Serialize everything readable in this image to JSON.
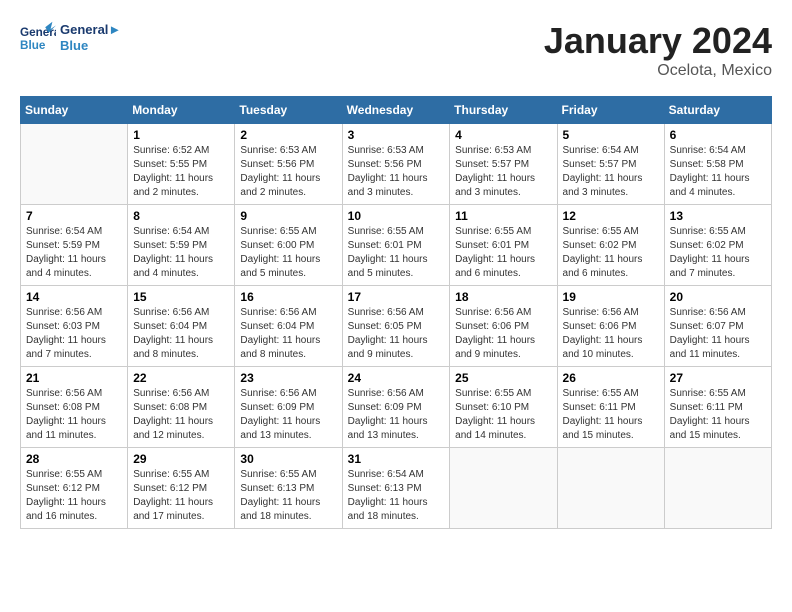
{
  "header": {
    "logo_line1": "General",
    "logo_line2": "Blue",
    "month_title": "January 2024",
    "location": "Ocelota, Mexico"
  },
  "weekdays": [
    "Sunday",
    "Monday",
    "Tuesday",
    "Wednesday",
    "Thursday",
    "Friday",
    "Saturday"
  ],
  "weeks": [
    [
      {
        "num": "",
        "info": ""
      },
      {
        "num": "1",
        "info": "Sunrise: 6:52 AM\nSunset: 5:55 PM\nDaylight: 11 hours\nand 2 minutes."
      },
      {
        "num": "2",
        "info": "Sunrise: 6:53 AM\nSunset: 5:56 PM\nDaylight: 11 hours\nand 2 minutes."
      },
      {
        "num": "3",
        "info": "Sunrise: 6:53 AM\nSunset: 5:56 PM\nDaylight: 11 hours\nand 3 minutes."
      },
      {
        "num": "4",
        "info": "Sunrise: 6:53 AM\nSunset: 5:57 PM\nDaylight: 11 hours\nand 3 minutes."
      },
      {
        "num": "5",
        "info": "Sunrise: 6:54 AM\nSunset: 5:57 PM\nDaylight: 11 hours\nand 3 minutes."
      },
      {
        "num": "6",
        "info": "Sunrise: 6:54 AM\nSunset: 5:58 PM\nDaylight: 11 hours\nand 4 minutes."
      }
    ],
    [
      {
        "num": "7",
        "info": "Sunrise: 6:54 AM\nSunset: 5:59 PM\nDaylight: 11 hours\nand 4 minutes."
      },
      {
        "num": "8",
        "info": "Sunrise: 6:54 AM\nSunset: 5:59 PM\nDaylight: 11 hours\nand 4 minutes."
      },
      {
        "num": "9",
        "info": "Sunrise: 6:55 AM\nSunset: 6:00 PM\nDaylight: 11 hours\nand 5 minutes."
      },
      {
        "num": "10",
        "info": "Sunrise: 6:55 AM\nSunset: 6:01 PM\nDaylight: 11 hours\nand 5 minutes."
      },
      {
        "num": "11",
        "info": "Sunrise: 6:55 AM\nSunset: 6:01 PM\nDaylight: 11 hours\nand 6 minutes."
      },
      {
        "num": "12",
        "info": "Sunrise: 6:55 AM\nSunset: 6:02 PM\nDaylight: 11 hours\nand 6 minutes."
      },
      {
        "num": "13",
        "info": "Sunrise: 6:55 AM\nSunset: 6:02 PM\nDaylight: 11 hours\nand 7 minutes."
      }
    ],
    [
      {
        "num": "14",
        "info": "Sunrise: 6:56 AM\nSunset: 6:03 PM\nDaylight: 11 hours\nand 7 minutes."
      },
      {
        "num": "15",
        "info": "Sunrise: 6:56 AM\nSunset: 6:04 PM\nDaylight: 11 hours\nand 8 minutes."
      },
      {
        "num": "16",
        "info": "Sunrise: 6:56 AM\nSunset: 6:04 PM\nDaylight: 11 hours\nand 8 minutes."
      },
      {
        "num": "17",
        "info": "Sunrise: 6:56 AM\nSunset: 6:05 PM\nDaylight: 11 hours\nand 9 minutes."
      },
      {
        "num": "18",
        "info": "Sunrise: 6:56 AM\nSunset: 6:06 PM\nDaylight: 11 hours\nand 9 minutes."
      },
      {
        "num": "19",
        "info": "Sunrise: 6:56 AM\nSunset: 6:06 PM\nDaylight: 11 hours\nand 10 minutes."
      },
      {
        "num": "20",
        "info": "Sunrise: 6:56 AM\nSunset: 6:07 PM\nDaylight: 11 hours\nand 11 minutes."
      }
    ],
    [
      {
        "num": "21",
        "info": "Sunrise: 6:56 AM\nSunset: 6:08 PM\nDaylight: 11 hours\nand 11 minutes."
      },
      {
        "num": "22",
        "info": "Sunrise: 6:56 AM\nSunset: 6:08 PM\nDaylight: 11 hours\nand 12 minutes."
      },
      {
        "num": "23",
        "info": "Sunrise: 6:56 AM\nSunset: 6:09 PM\nDaylight: 11 hours\nand 13 minutes."
      },
      {
        "num": "24",
        "info": "Sunrise: 6:56 AM\nSunset: 6:09 PM\nDaylight: 11 hours\nand 13 minutes."
      },
      {
        "num": "25",
        "info": "Sunrise: 6:55 AM\nSunset: 6:10 PM\nDaylight: 11 hours\nand 14 minutes."
      },
      {
        "num": "26",
        "info": "Sunrise: 6:55 AM\nSunset: 6:11 PM\nDaylight: 11 hours\nand 15 minutes."
      },
      {
        "num": "27",
        "info": "Sunrise: 6:55 AM\nSunset: 6:11 PM\nDaylight: 11 hours\nand 15 minutes."
      }
    ],
    [
      {
        "num": "28",
        "info": "Sunrise: 6:55 AM\nSunset: 6:12 PM\nDaylight: 11 hours\nand 16 minutes."
      },
      {
        "num": "29",
        "info": "Sunrise: 6:55 AM\nSunset: 6:12 PM\nDaylight: 11 hours\nand 17 minutes."
      },
      {
        "num": "30",
        "info": "Sunrise: 6:55 AM\nSunset: 6:13 PM\nDaylight: 11 hours\nand 18 minutes."
      },
      {
        "num": "31",
        "info": "Sunrise: 6:54 AM\nSunset: 6:13 PM\nDaylight: 11 hours\nand 18 minutes."
      },
      {
        "num": "",
        "info": ""
      },
      {
        "num": "",
        "info": ""
      },
      {
        "num": "",
        "info": ""
      }
    ]
  ]
}
